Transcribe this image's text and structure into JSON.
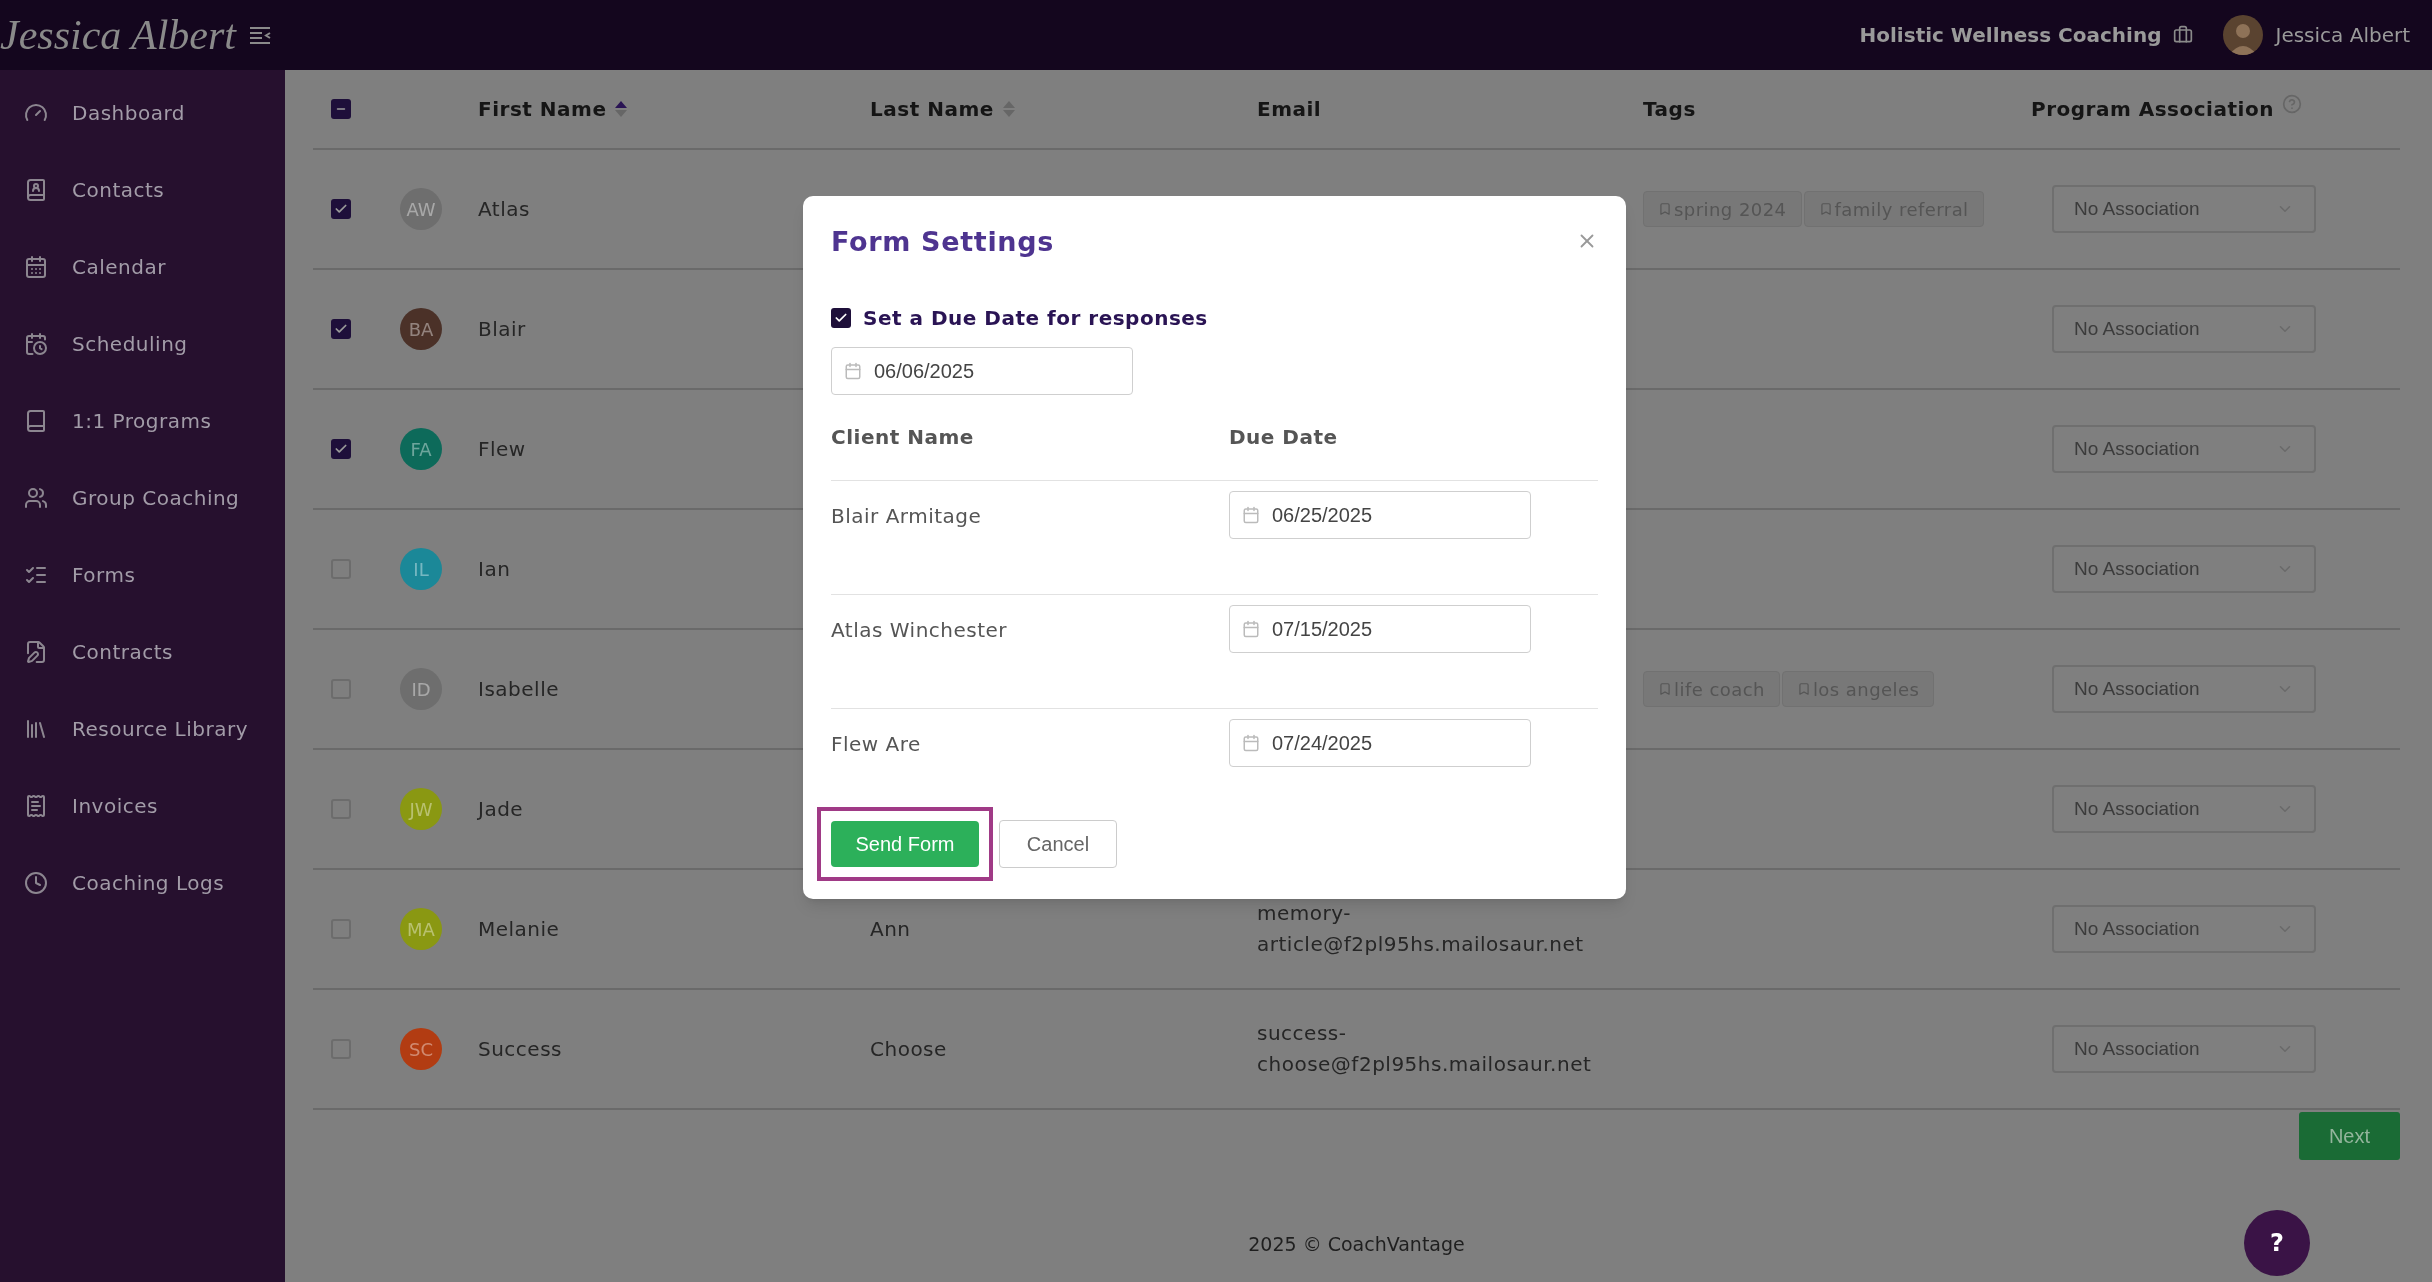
{
  "header": {
    "logo": "Jessica Albert",
    "business_name": "Holistic Wellness Coaching",
    "user_name": "Jessica Albert"
  },
  "sidebar": {
    "items": [
      {
        "label": "Dashboard"
      },
      {
        "label": "Contacts"
      },
      {
        "label": "Calendar"
      },
      {
        "label": "Scheduling"
      },
      {
        "label": "1:1 Programs"
      },
      {
        "label": "Group Coaching"
      },
      {
        "label": "Forms"
      },
      {
        "label": "Contracts"
      },
      {
        "label": "Resource Library"
      },
      {
        "label": "Invoices"
      },
      {
        "label": "Coaching Logs"
      }
    ]
  },
  "table": {
    "select_all": {
      "indeterminate": true
    },
    "columns": [
      {
        "label": "First Name",
        "sorted": true,
        "help": false
      },
      {
        "label": "Last Name",
        "sorted": false,
        "help": false
      },
      {
        "label": "Email",
        "help": false
      },
      {
        "label": "Tags",
        "help": false
      },
      {
        "label": "Program Association",
        "help": true
      }
    ],
    "rows": [
      {
        "selected": true,
        "initials": "AW",
        "color": "#6e6e6e",
        "first_name": "Atlas",
        "tags": [
          "spring 2024",
          "family referral"
        ],
        "association": "No Association"
      },
      {
        "selected": true,
        "initials": "BA",
        "color": "#4b3128",
        "first_name": "Blair",
        "tags": [],
        "association": "No Association"
      },
      {
        "selected": true,
        "initials": "FA",
        "color": "#0d6a5a",
        "first_name": "Flew",
        "tags": [],
        "association": "No Association"
      },
      {
        "selected": false,
        "initials": "IL",
        "color": "#1b8898",
        "first_name": "Ian",
        "tags": [],
        "association": "No Association"
      },
      {
        "selected": false,
        "initials": "ID",
        "color": "#6e6e6e",
        "first_name": "Isabelle",
        "tags": [
          "life coach",
          "los angeles"
        ],
        "association": "No Association"
      },
      {
        "selected": false,
        "initials": "JW",
        "color": "#8a9812",
        "first_name": "Jade",
        "tags": [],
        "association": "No Association"
      },
      {
        "selected": false,
        "initials": "MA",
        "color": "#8a9812",
        "first_name": "Melanie",
        "last_name": "Ann",
        "email": "memory-article@f2pl95hs.mailosaur.net",
        "tags": [],
        "association": "No Association"
      },
      {
        "selected": false,
        "initials": "SC",
        "color": "#b23c12",
        "first_name": "Success",
        "last_name": "Choose",
        "email": "success-choose@f2pl95hs.mailosaur.net",
        "tags": [],
        "association": "No Association"
      }
    ],
    "next_button": "Next"
  },
  "footer": "2025 © CoachVantage",
  "help_button": "?",
  "modal": {
    "title": "Form Settings",
    "due_date_checkbox": {
      "label": "Set a Due Date for responses",
      "checked": true
    },
    "due_date": "06/06/2025",
    "columns": [
      "Client Name",
      "Due Date"
    ],
    "clients": [
      {
        "name": "Blair Armitage",
        "due_date": "06/25/2025"
      },
      {
        "name": "Atlas Winchester",
        "due_date": "07/15/2025"
      },
      {
        "name": "Flew Are",
        "due_date": "07/24/2025"
      }
    ],
    "send_button": {
      "label": "Send Form",
      "highlighted": true
    },
    "cancel_button": "Cancel"
  }
}
